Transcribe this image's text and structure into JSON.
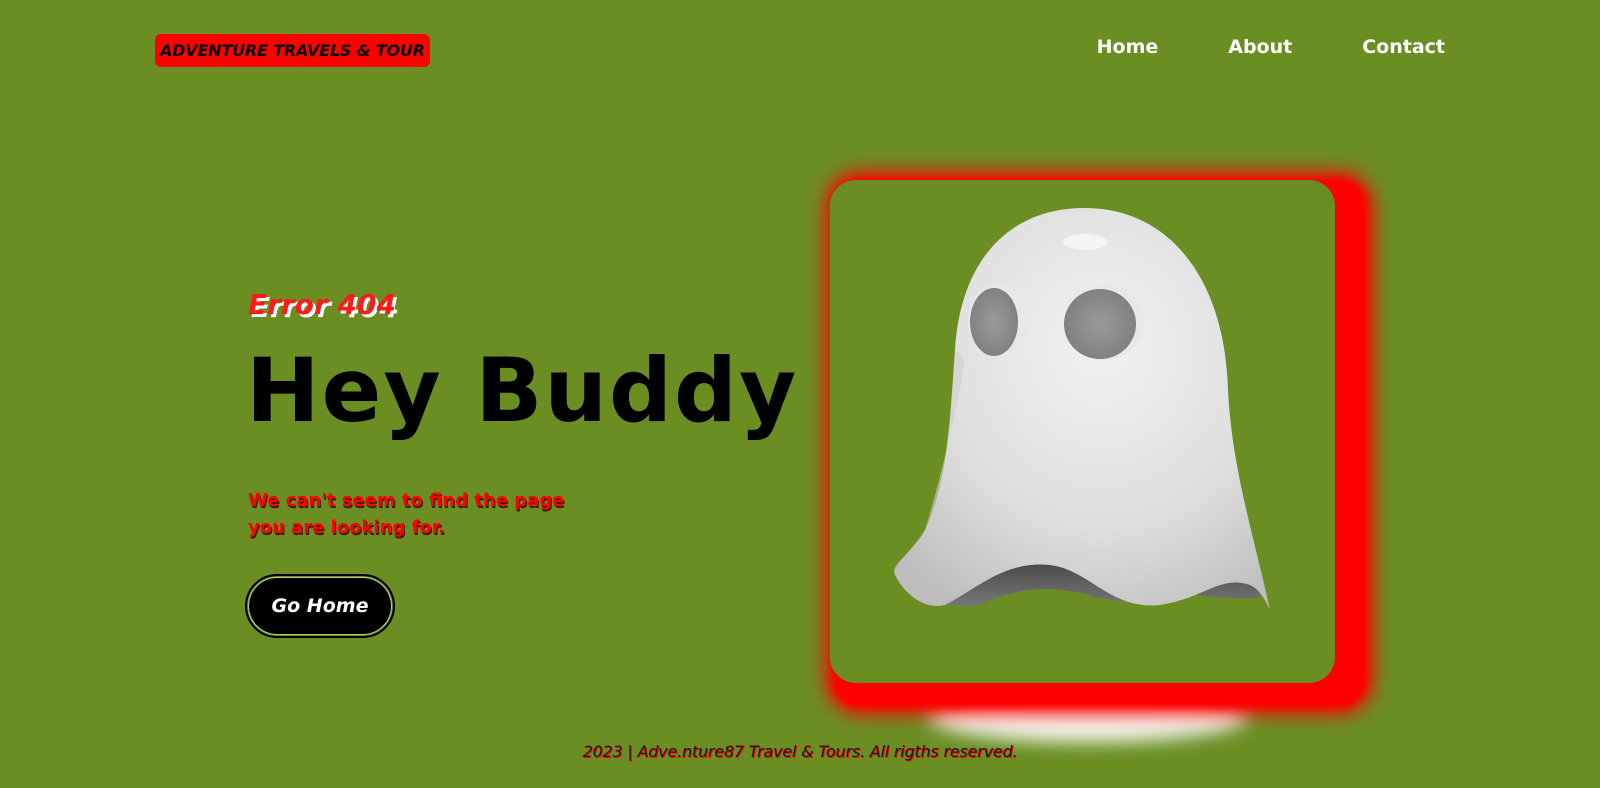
{
  "header": {
    "brand": "ADVENTURE TRAVELS & TOUR",
    "nav": [
      {
        "label": "Home"
      },
      {
        "label": "About"
      },
      {
        "label": "Contact"
      }
    ]
  },
  "hero": {
    "error_code": "Error 404",
    "headline": "Hey Buddy",
    "message": "We can't seem to find the page you are looking for.",
    "button_label": "Go Home",
    "image_icon": "ghost-icon"
  },
  "footer": {
    "text": "2023  |  Adve.nture87 Travel & Tours. All rigths reserved."
  },
  "colors": {
    "background": "#6b8e23",
    "accent": "#ff0000",
    "text_dark": "#000000",
    "text_light": "#ffffff"
  }
}
